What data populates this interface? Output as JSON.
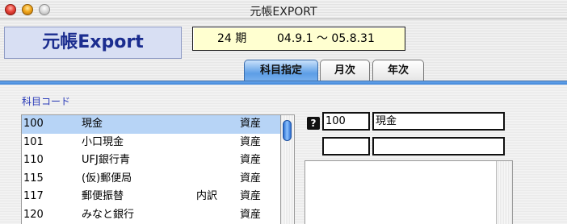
{
  "window": {
    "title": "元帳EXPORT"
  },
  "header": {
    "app_title": "元帳Export",
    "period_term": "24 期",
    "period_range": "04.9.1 ～ 05.8.31"
  },
  "tabs": [
    {
      "label": "科目指定",
      "active": true
    },
    {
      "label": "月次",
      "active": false
    },
    {
      "label": "年次",
      "active": false
    }
  ],
  "account_list": {
    "label": "科目コード",
    "rows": [
      {
        "code": "100",
        "name": "現金",
        "extra": "",
        "category": "資産",
        "selected": true
      },
      {
        "code": "101",
        "name": "小口現金",
        "extra": "",
        "category": "資産",
        "selected": false
      },
      {
        "code": "110",
        "name": "UFJ銀行青",
        "extra": "",
        "category": "資産",
        "selected": false
      },
      {
        "code": "115",
        "name": "(仮)郵便局",
        "extra": "",
        "category": "資産",
        "selected": false
      },
      {
        "code": "117",
        "name": "郵便振替",
        "extra": "内訳",
        "category": "資産",
        "selected": false
      },
      {
        "code": "120",
        "name": "みなと銀行",
        "extra": "",
        "category": "資産",
        "selected": false
      }
    ]
  },
  "detail": {
    "help_icon": "?",
    "code_value": "100",
    "name_value": "現金",
    "extra_code_value": "",
    "extra_name_value": ""
  },
  "colors": {
    "accent": "#3d84d6",
    "selection": "#b7d4f6",
    "app_title": "#1b2d8f",
    "section_label": "#2a3bb8"
  }
}
